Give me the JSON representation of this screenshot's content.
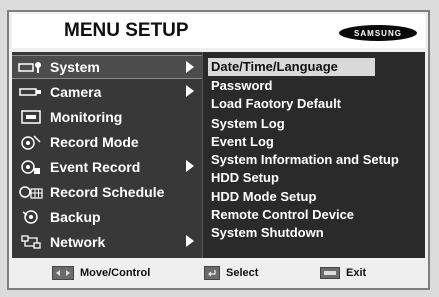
{
  "header": {
    "title": "MENU SETUP",
    "brand_logo": "SAMSUNG"
  },
  "left_menu": [
    {
      "label": "System",
      "icon": "system-icon",
      "has_submenu": true,
      "active": true
    },
    {
      "label": "Camera",
      "icon": "camera-icon",
      "has_submenu": true,
      "active": false
    },
    {
      "label": "Monitoring",
      "icon": "monitor-icon",
      "has_submenu": false,
      "active": false
    },
    {
      "label": "Record Mode",
      "icon": "record-mode-icon",
      "has_submenu": false,
      "active": false
    },
    {
      "label": "Event Record",
      "icon": "event-record-icon",
      "has_submenu": true,
      "active": false
    },
    {
      "label": "Record Schedule",
      "icon": "record-schedule-icon",
      "has_submenu": false,
      "active": false
    },
    {
      "label": "Backup",
      "icon": "backup-icon",
      "has_submenu": false,
      "active": false
    },
    {
      "label": "Network",
      "icon": "network-icon",
      "has_submenu": true,
      "active": false
    }
  ],
  "submenu": [
    {
      "label": "Date/Time/Language",
      "selected": true
    },
    {
      "label": "Password",
      "selected": false
    },
    {
      "label": "Load Faotory Default",
      "selected": false
    },
    {
      "label": "System Log",
      "selected": false
    },
    {
      "label": "Event Log",
      "selected": false
    },
    {
      "label": "System Information and Setup",
      "selected": false
    },
    {
      "label": "HDD Setup",
      "selected": false
    },
    {
      "label": "HDD Mode Setup",
      "selected": false
    },
    {
      "label": "Remote Control Device",
      "selected": false
    },
    {
      "label": "System Shutdown",
      "selected": false
    }
  ],
  "footer": {
    "move_label": "Move/Control",
    "select_label": "Select",
    "exit_label": "Exit"
  },
  "colors": {
    "panel_bg": "#2a2a2a",
    "selection_bg": "#d9d9d9",
    "text": "#ffffff"
  }
}
